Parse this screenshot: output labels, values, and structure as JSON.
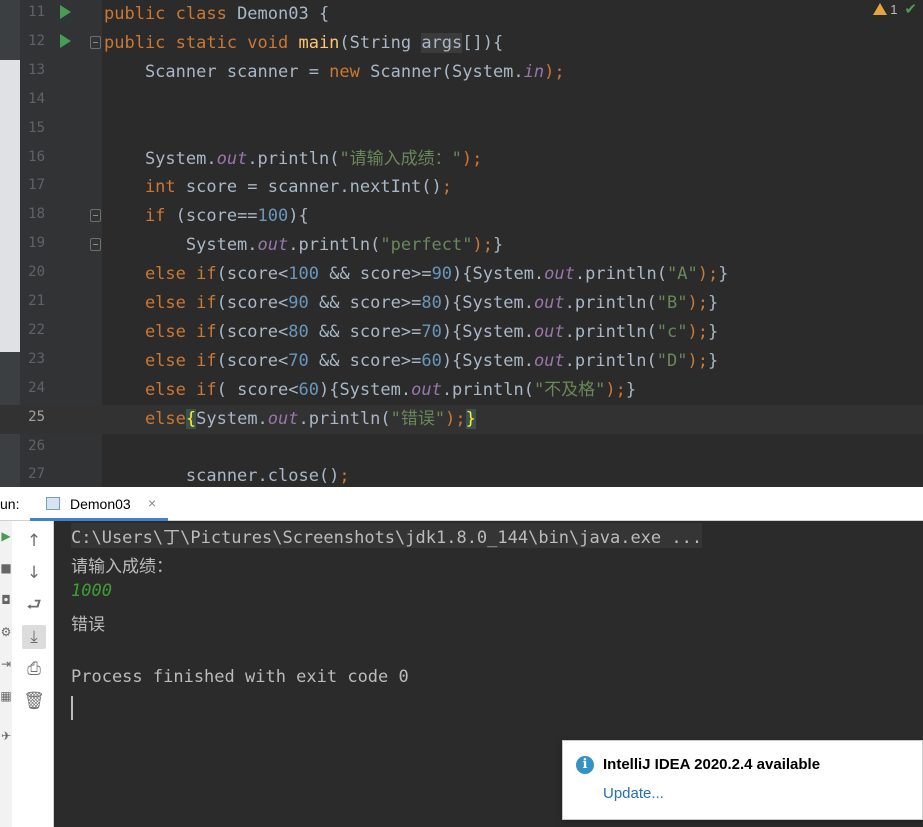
{
  "editor": {
    "inspection": {
      "warning_count": "1"
    },
    "lines": [
      {
        "num": "11",
        "run": true,
        "fold": false,
        "current": false,
        "tokens": [
          [
            "kw",
            "public class "
          ],
          [
            "",
            "Demon03 {"
          ]
        ]
      },
      {
        "num": "12",
        "run": true,
        "fold": true,
        "current": false,
        "tokens": [
          [
            "kw",
            "public static void "
          ],
          [
            "fn",
            "main"
          ],
          [
            "",
            "(String "
          ],
          [
            "unused",
            "args"
          ],
          [
            "",
            "[]){"
          ]
        ]
      },
      {
        "num": "13",
        "run": false,
        "fold": false,
        "current": false,
        "tokens": [
          [
            "",
            "    Scanner scanner = "
          ],
          [
            "kw",
            "new "
          ],
          [
            "",
            "Scanner(System."
          ],
          [
            "fld",
            "in"
          ],
          [
            "kw",
            ");"
          ]
        ]
      },
      {
        "num": "14",
        "run": false,
        "fold": false,
        "current": false,
        "tokens": []
      },
      {
        "num": "15",
        "run": false,
        "fold": false,
        "current": false,
        "tokens": []
      },
      {
        "num": "16",
        "run": false,
        "fold": false,
        "current": false,
        "tokens": [
          [
            "",
            "    System."
          ],
          [
            "fld",
            "out"
          ],
          [
            "",
            ".println("
          ],
          [
            "str",
            "\"请输入成绩：\""
          ],
          [
            "kw",
            ");"
          ]
        ]
      },
      {
        "num": "17",
        "run": false,
        "fold": false,
        "current": false,
        "tokens": [
          [
            "kw",
            "    int "
          ],
          [
            "",
            "score = scanner.nextInt()"
          ],
          [
            "kw",
            ";"
          ]
        ]
      },
      {
        "num": "18",
        "run": false,
        "fold": true,
        "current": false,
        "tokens": [
          [
            "kw",
            "    if "
          ],
          [
            "",
            "(score=="
          ],
          [
            "num",
            "100"
          ],
          [
            "",
            "){"
          ]
        ]
      },
      {
        "num": "19",
        "run": false,
        "fold": true,
        "current": false,
        "tokens": [
          [
            "",
            "        System."
          ],
          [
            "fld",
            "out"
          ],
          [
            "",
            ".println("
          ],
          [
            "str",
            "\"perfect\""
          ],
          [
            "kw",
            ");"
          ],
          [
            "",
            "}"
          ]
        ]
      },
      {
        "num": "20",
        "run": false,
        "fold": false,
        "current": false,
        "tokens": [
          [
            "kw",
            "    else if"
          ],
          [
            "",
            "(score<"
          ],
          [
            "num",
            "100"
          ],
          [
            "",
            " && score>="
          ],
          [
            "num",
            "90"
          ],
          [
            "",
            "){System."
          ],
          [
            "fld",
            "out"
          ],
          [
            "",
            ".println("
          ],
          [
            "str",
            "\"A\""
          ],
          [
            "kw",
            ");"
          ],
          [
            "",
            "}"
          ]
        ]
      },
      {
        "num": "21",
        "run": false,
        "fold": false,
        "current": false,
        "tokens": [
          [
            "kw",
            "    else if"
          ],
          [
            "",
            "(score<"
          ],
          [
            "num",
            "90"
          ],
          [
            "",
            " && score>="
          ],
          [
            "num",
            "80"
          ],
          [
            "",
            "){System."
          ],
          [
            "fld",
            "out"
          ],
          [
            "",
            ".println("
          ],
          [
            "str",
            "\"B\""
          ],
          [
            "kw",
            ");"
          ],
          [
            "",
            "}"
          ]
        ]
      },
      {
        "num": "22",
        "run": false,
        "fold": false,
        "current": false,
        "tokens": [
          [
            "kw",
            "    else if"
          ],
          [
            "",
            "(score<"
          ],
          [
            "num",
            "80"
          ],
          [
            "",
            " && score>="
          ],
          [
            "num",
            "70"
          ],
          [
            "",
            "){System."
          ],
          [
            "fld",
            "out"
          ],
          [
            "",
            ".println("
          ],
          [
            "str",
            "\"c\""
          ],
          [
            "kw",
            ");"
          ],
          [
            "",
            "}"
          ]
        ]
      },
      {
        "num": "23",
        "run": false,
        "fold": false,
        "current": false,
        "tokens": [
          [
            "kw",
            "    else if"
          ],
          [
            "",
            "(score<"
          ],
          [
            "num",
            "70"
          ],
          [
            "",
            " && score>="
          ],
          [
            "num",
            "60"
          ],
          [
            "",
            "){System."
          ],
          [
            "fld",
            "out"
          ],
          [
            "",
            ".println("
          ],
          [
            "str",
            "\"D\""
          ],
          [
            "kw",
            ");"
          ],
          [
            "",
            "}"
          ]
        ]
      },
      {
        "num": "24",
        "run": false,
        "fold": false,
        "current": false,
        "tokens": [
          [
            "kw",
            "    else if"
          ],
          [
            "",
            "( score<"
          ],
          [
            "num",
            "60"
          ],
          [
            "",
            "){System."
          ],
          [
            "fld",
            "out"
          ],
          [
            "",
            ".println("
          ],
          [
            "str",
            "\"不及格\""
          ],
          [
            "kw",
            ");"
          ],
          [
            "",
            "}"
          ]
        ]
      },
      {
        "num": "25",
        "run": false,
        "fold": false,
        "current": true,
        "tokens": [
          [
            "kw",
            "    else"
          ],
          [
            "brace-hl",
            "{"
          ],
          [
            "",
            "System."
          ],
          [
            "fld",
            "out"
          ],
          [
            "",
            ".println("
          ],
          [
            "str",
            "\"错误\""
          ],
          [
            "kw",
            ");"
          ],
          [
            "brace-hl",
            "}"
          ]
        ]
      },
      {
        "num": "26",
        "run": false,
        "fold": false,
        "current": false,
        "tokens": []
      },
      {
        "num": "27",
        "run": false,
        "fold": false,
        "current": false,
        "tokens": [
          [
            "",
            "        scanner.close()"
          ],
          [
            "kw",
            ";"
          ]
        ]
      }
    ]
  },
  "run_panel": {
    "label": "un:",
    "tab_label": "Demon03",
    "tab_close": "×",
    "console": {
      "command": "C:\\Users\\丁\\Pictures\\Screenshots\\jdk1.8.0_144\\bin\\java.exe ...",
      "prompt": "请输入成绩：",
      "input": "1000",
      "output": "错误",
      "finished": "Process finished with exit code 0"
    },
    "toolbar_icons": [
      "up-arrow-icon",
      "down-arrow-icon",
      "soft-wrap-icon",
      "scroll-to-end-icon",
      "print-icon",
      "trash-icon"
    ]
  },
  "notification": {
    "title": "IntelliJ IDEA 2020.2.4 available",
    "action": "Update..."
  }
}
